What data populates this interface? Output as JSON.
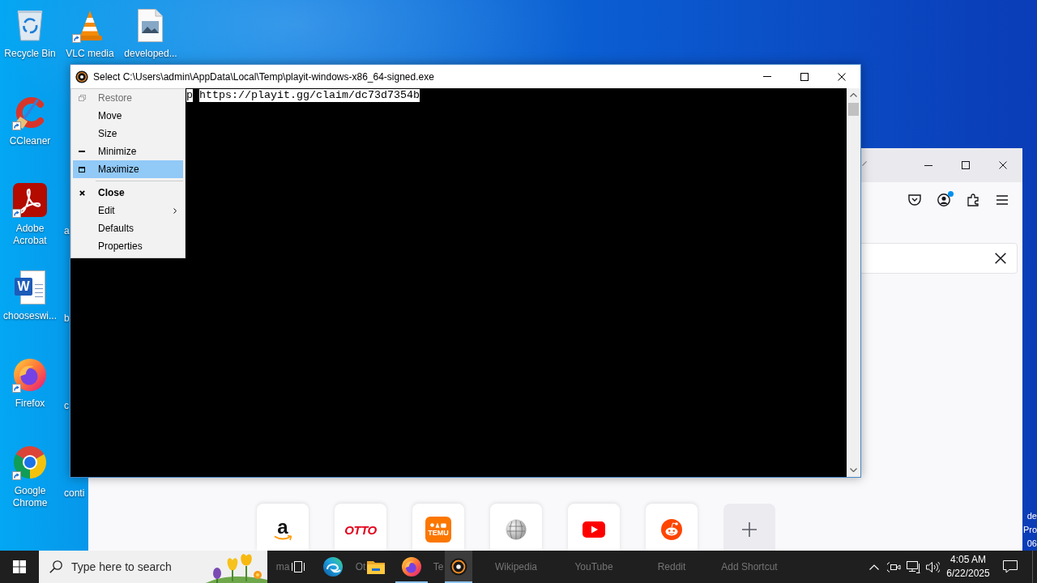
{
  "desktop": {
    "columns": [
      {
        "icons": [
          {
            "label": "Recycle Bin",
            "kind": "recycle",
            "shortcut": false
          },
          {
            "label": "CCleaner",
            "kind": "cleaner",
            "shortcut": true
          },
          {
            "label": "Adobe Acrobat",
            "kind": "pdf",
            "shortcut": true
          },
          {
            "label": "chooseswi...",
            "kind": "document",
            "logo": "W",
            "shortcut": false
          },
          {
            "label": "Firefox",
            "kind": "firefox",
            "shortcut": true
          },
          {
            "label": "Google Chrome",
            "kind": "chrome",
            "shortcut": true
          }
        ]
      },
      {
        "icons": [
          {
            "label": "VLC media",
            "kind": "cone",
            "shortcut": true
          }
        ],
        "clipped_labels": [
          "a",
          "b",
          "c",
          "conti"
        ]
      },
      {
        "icons": [
          {
            "label": "developed...",
            "kind": "picture",
            "shortcut": false
          }
        ]
      }
    ],
    "watermark_lines": [
      "de",
      "Pro",
      "06"
    ]
  },
  "console_window": {
    "title": "Select C:\\Users\\admin\\AppData\\Local\\Temp\\playit-windows-x86_64-signed.exe",
    "output": [
      {
        "text": "p",
        "selected": true
      },
      {
        "text": "https://playit.gg/claim/dc73d7354b",
        "selected": true
      }
    ],
    "system_menu": [
      {
        "items": [
          {
            "label": "Restore",
            "kind": "restore",
            "disabled": true,
            "selected": false,
            "default": false,
            "submenu": false
          },
          {
            "label": "Move",
            "kind": "plain",
            "disabled": false,
            "selected": false,
            "default": false,
            "submenu": false
          },
          {
            "label": "Size",
            "kind": "plain",
            "disabled": false,
            "selected": false,
            "default": false,
            "submenu": false
          },
          {
            "label": "Minimize",
            "kind": "minimize",
            "disabled": false,
            "selected": false,
            "default": false,
            "submenu": false
          },
          {
            "label": "Maximize",
            "kind": "maximize",
            "disabled": false,
            "selected": true,
            "default": false,
            "submenu": false
          }
        ]
      },
      {
        "items": [
          {
            "label": "Close",
            "kind": "close",
            "disabled": false,
            "selected": false,
            "default": true,
            "submenu": false
          },
          {
            "label": "Edit",
            "kind": "plain",
            "disabled": false,
            "selected": false,
            "default": false,
            "submenu": true
          },
          {
            "label": "Defaults",
            "kind": "plain",
            "disabled": false,
            "selected": false,
            "default": false,
            "submenu": false
          },
          {
            "label": "Properties",
            "kind": "plain",
            "disabled": false,
            "selected": false,
            "default": false,
            "submenu": false
          }
        ]
      }
    ]
  },
  "browser_window": {
    "toolbar": [
      {
        "kind": "pocket",
        "badge": false
      },
      {
        "kind": "account",
        "badge": true
      },
      {
        "kind": "extensions",
        "badge": false
      },
      {
        "kind": "menu",
        "badge": false
      }
    ],
    "shortcuts": [
      {
        "kind": "amazon",
        "logo": "a",
        "label": "ma"
      },
      {
        "kind": "otto",
        "logo": "OTTO",
        "label": "Ot"
      },
      {
        "kind": "temu",
        "logo": "TEMU",
        "label": "Te"
      },
      {
        "kind": "wikipedia",
        "label": "Wikipedia"
      },
      {
        "kind": "youtube",
        "label": "YouTube"
      },
      {
        "kind": "reddit",
        "label": "Reddit"
      },
      {
        "kind": "add",
        "label": "Add Shortcut"
      }
    ]
  },
  "taskbar": {
    "search": {
      "placeholder": "Type here to search"
    },
    "apps": [
      {
        "kind": "taskview",
        "running": false,
        "selected": false
      },
      {
        "kind": "edge",
        "running": false,
        "selected": false
      },
      {
        "kind": "explorer",
        "running": false,
        "selected": false
      },
      {
        "kind": "firefox",
        "running": true,
        "selected": false
      },
      {
        "kind": "playit",
        "running": true,
        "selected": true
      }
    ],
    "tray": [
      {
        "kind": "chevron"
      },
      {
        "kind": "meet"
      },
      {
        "kind": "network"
      },
      {
        "kind": "volume"
      }
    ],
    "clock": {
      "time": "4:05 AM",
      "date": "6/22/2025"
    }
  }
}
